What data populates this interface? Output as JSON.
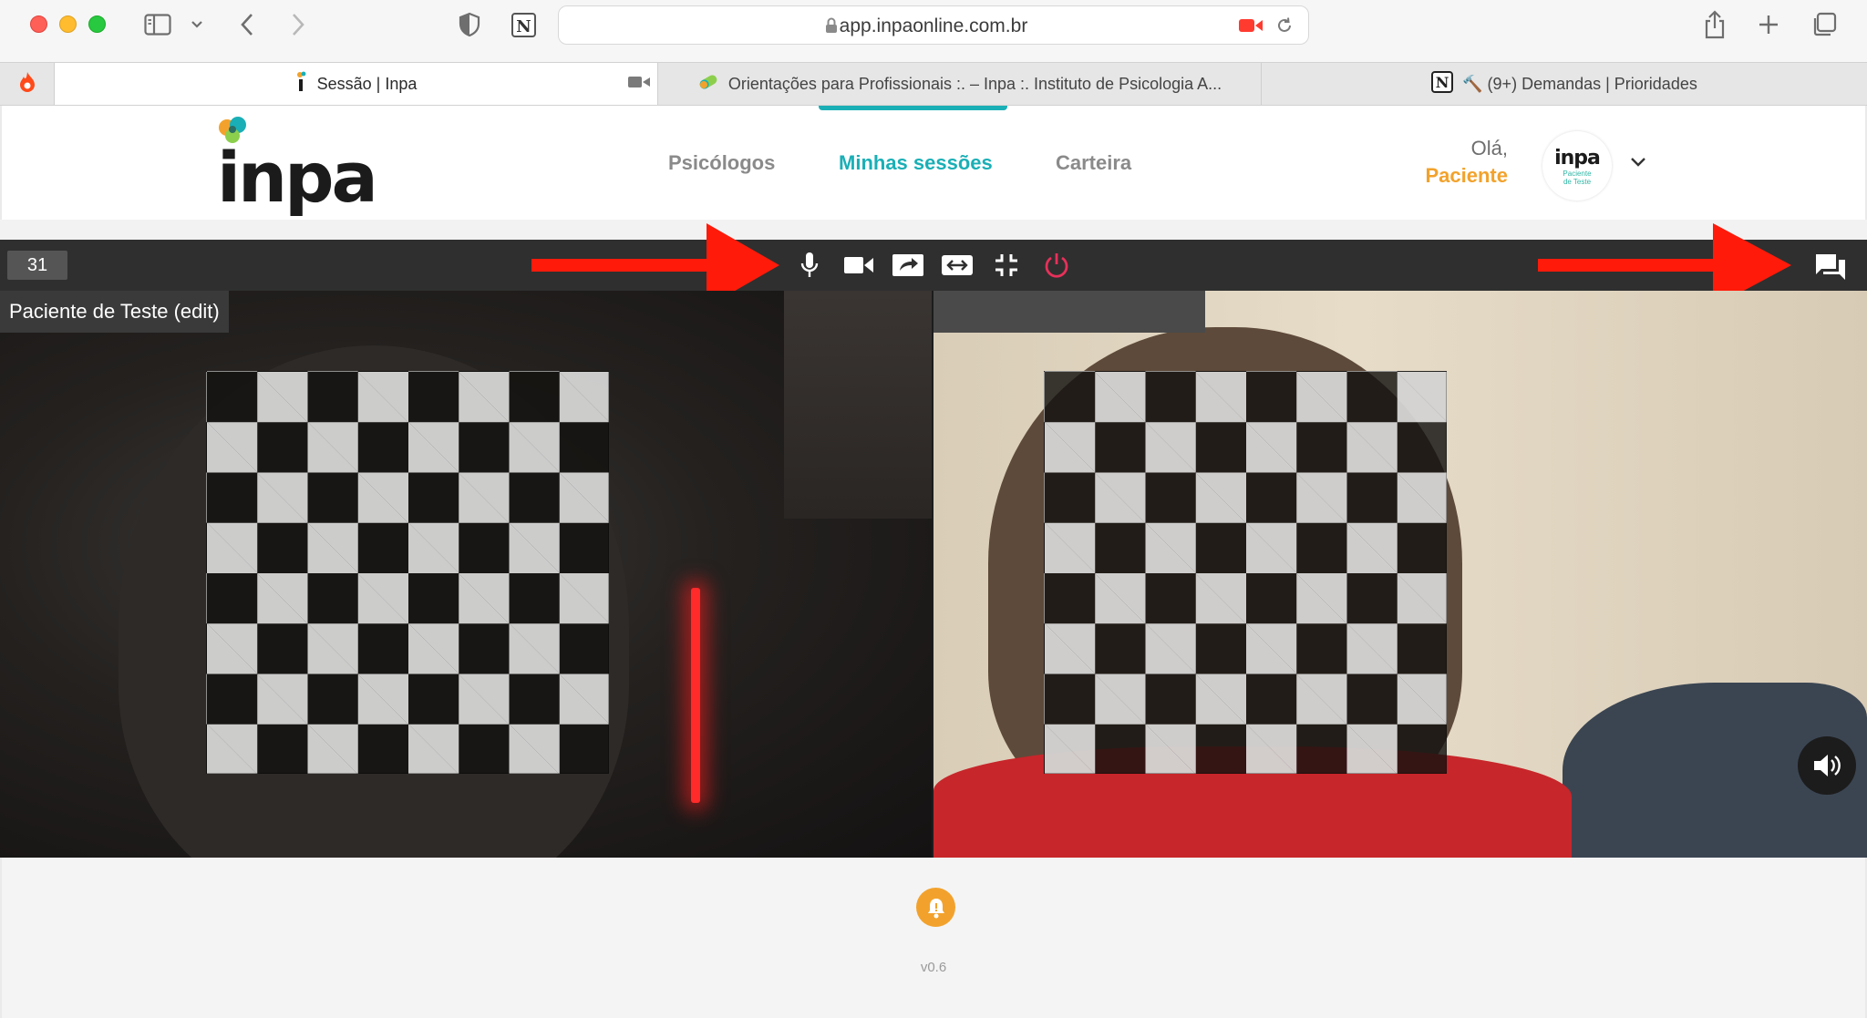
{
  "browser": {
    "url": "app.inpaonline.com.br",
    "tabs": [
      {
        "label": "Sessão | Inpa",
        "active": true
      },
      {
        "label": "Orientações para Profissionais :. – Inpa :. Instituto de Psicologia A..."
      },
      {
        "label": "🔨 (9+) Demandas | Prioridades"
      }
    ]
  },
  "header": {
    "logo_text": "inpa",
    "nav": [
      {
        "label": "Psicólogos"
      },
      {
        "label": "Minhas sessões",
        "active": true
      },
      {
        "label": "Carteira"
      }
    ],
    "greeting": "Olá,",
    "user_name": "Paciente",
    "avatar_text": "inpa",
    "avatar_subtext": "Paciente de Teste"
  },
  "call": {
    "timer": "31",
    "participant_left": "Paciente de Teste (edit)",
    "controls": [
      "microphone-icon",
      "camera-icon",
      "share-screen-icon",
      "switch-camera-icon",
      "exit-fullscreen-icon",
      "power-icon",
      "chat-icon",
      "volume-icon"
    ],
    "colors": {
      "accent": "#1aafb6",
      "end_call": "#e8305a",
      "brand_orange": "#f2a22c",
      "arrow": "#ff1a0a"
    }
  },
  "footer": {
    "version": "v0.6"
  }
}
